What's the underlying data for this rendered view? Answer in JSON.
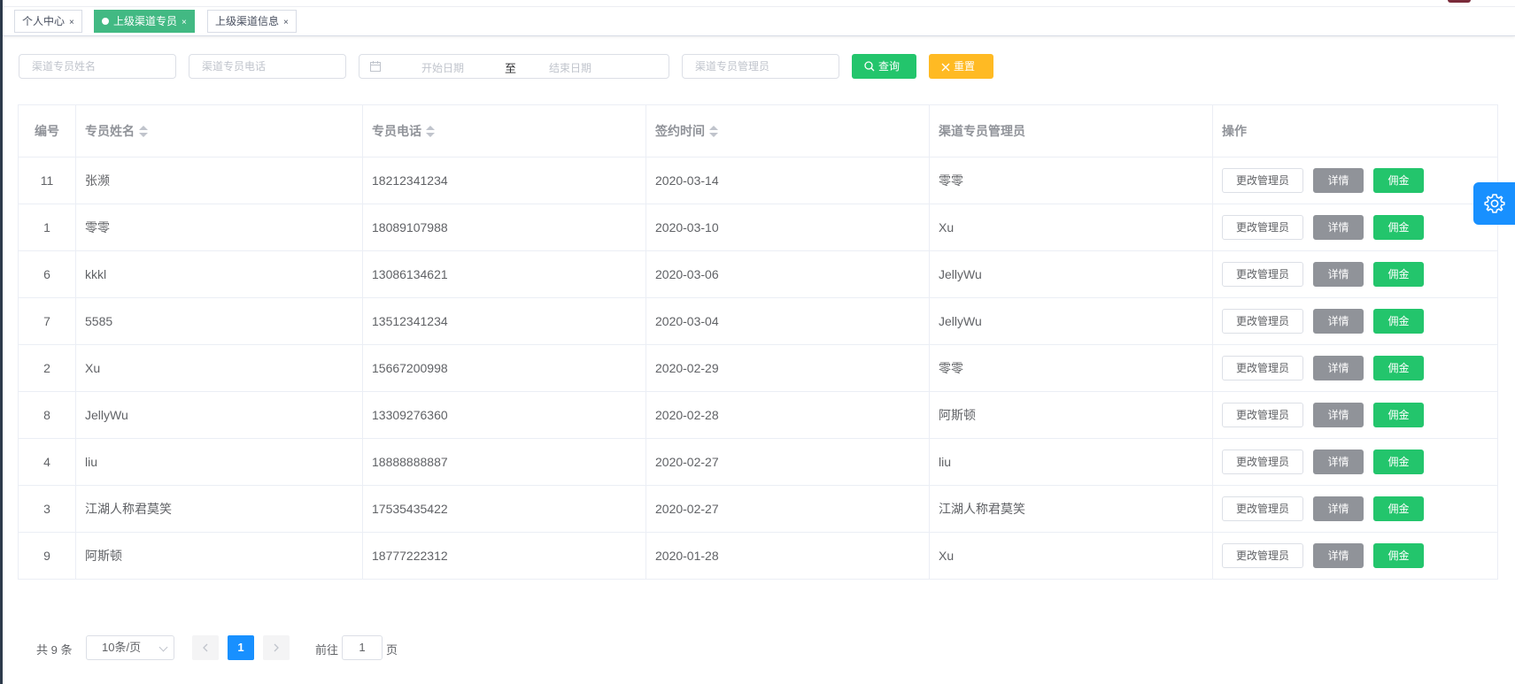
{
  "tags": [
    {
      "label": "个人中心",
      "active": false
    },
    {
      "label": "上级渠道专员",
      "active": true
    },
    {
      "label": "上级渠道信息",
      "active": false
    }
  ],
  "tag_close": "×",
  "filters": {
    "name_placeholder": "渠道专员姓名",
    "phone_placeholder": "渠道专员电话",
    "start_date_placeholder": "开始日期",
    "range_separator": "至",
    "end_date_placeholder": "结束日期",
    "manager_placeholder": "渠道专员管理员",
    "query_label": "查询",
    "reset_label": "重置"
  },
  "colors": {
    "active_tag": "#42b983",
    "query_button": "#23c56c",
    "reset_button": "#ffba23",
    "detail_button": "#909399",
    "commission_button": "#23c56c",
    "primary": "#1890ff"
  },
  "table": {
    "columns": [
      "编号",
      "专员姓名",
      "专员电话",
      "签约时间",
      "渠道专员管理员",
      "操作"
    ],
    "actions": {
      "change_manager": "更改管理员",
      "detail": "详情",
      "commission": "佣金"
    },
    "rows": [
      {
        "id": "11",
        "name": "张濒",
        "phone": "18212341234",
        "date": "2020-03-14",
        "manager": "零零"
      },
      {
        "id": "1",
        "name": "零零",
        "phone": "18089107988",
        "date": "2020-03-10",
        "manager": "Xu"
      },
      {
        "id": "6",
        "name": "kkkl",
        "phone": "13086134621",
        "date": "2020-03-06",
        "manager": "JellyWu"
      },
      {
        "id": "7",
        "name": "5585",
        "phone": "13512341234",
        "date": "2020-03-04",
        "manager": "JellyWu"
      },
      {
        "id": "2",
        "name": "Xu",
        "phone": "15667200998",
        "date": "2020-02-29",
        "manager": "零零"
      },
      {
        "id": "8",
        "name": "JellyWu",
        "phone": "13309276360",
        "date": "2020-02-28",
        "manager": "阿斯顿"
      },
      {
        "id": "4",
        "name": "liu",
        "phone": "18888888887",
        "date": "2020-02-27",
        "manager": "liu"
      },
      {
        "id": "3",
        "name": "江湖人称君莫笑",
        "phone": "17535435422",
        "date": "2020-02-27",
        "manager": "江湖人称君莫笑"
      },
      {
        "id": "9",
        "name": "阿斯顿",
        "phone": "18777222312",
        "date": "2020-01-28",
        "manager": "Xu"
      }
    ]
  },
  "pagination": {
    "total_text": "共 9 条",
    "page_size": "10条/页",
    "current_page": "1",
    "goto_label": "前往",
    "goto_value": "1",
    "page_unit": "页"
  },
  "icons": {
    "calendar": "calendar-icon",
    "search": "search-icon",
    "reset": "close-icon",
    "settings": "gear-icon",
    "prev": "chevron-left-icon",
    "next": "chevron-right-icon"
  }
}
